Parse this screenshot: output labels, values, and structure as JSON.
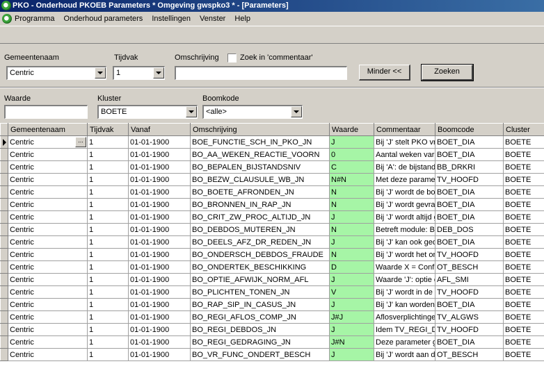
{
  "title": "PKO - Onderhoud PKOEB Parameters * Omgeving gwspko3 * - [Parameters]",
  "menu": [
    "Programma",
    "Onderhoud parameters",
    "Instellingen",
    "Venster",
    "Help"
  ],
  "filters": {
    "gemeentenaam_label": "Gemeentenaam",
    "gemeentenaam_value": "Centric",
    "tijdvak_label": "Tijdvak",
    "tijdvak_value": "1",
    "omschrijving_label": "Omschrijving",
    "omschrijving_value": "",
    "zoek_commentaar_label": "Zoek in 'commentaar'",
    "minder_label": "Minder <<",
    "zoeken_label": "Zoeken",
    "waarde_label": "Waarde",
    "waarde_value": "",
    "kluster_label": "Kluster",
    "kluster_value": "BOETE",
    "boomkode_label": "Boomkode",
    "boomkode_value": "<alle>"
  },
  "grid": {
    "columns": [
      "Gemeentenaam",
      "Tijdvak",
      "Vanaf",
      "Omschrijving",
      "Waarde",
      "Commentaar",
      "Boomcode",
      "Cluster"
    ],
    "rows": [
      [
        "Centric",
        "1",
        "01-01-1900",
        "BOE_FUNCTIE_SCH_IN_PKO_JN",
        "J",
        "Bij 'J' stelt PKO vra",
        "BOET_DIA",
        "BOETE"
      ],
      [
        "Centric",
        "1",
        "01-01-1900",
        "BO_AA_WEKEN_REACTIE_VOORN",
        "0",
        "Aantal weken var",
        "BOET_DIA",
        "BOETE"
      ],
      [
        "Centric",
        "1",
        "01-01-1900",
        "BO_BEPALEN_BIJSTANDSNIV",
        "C",
        "Bij 'A': de bijstands",
        "BB_DRKRI",
        "BOETE"
      ],
      [
        "Centric",
        "1",
        "01-01-1900",
        "BO_BEZW_CLAUSULE_WB_JN",
        "N#N",
        "Met deze paramet",
        "TV_HOOFD",
        "BOETE"
      ],
      [
        "Centric",
        "1",
        "01-01-1900",
        "BO_BOETE_AFRONDEN_JN",
        "N",
        "Bij 'J' wordt de boe",
        "BOET_DIA",
        "BOETE"
      ],
      [
        "Centric",
        "1",
        "01-01-1900",
        "BO_BRONNEN_IN_RAP_JN",
        "N",
        "Bij 'J' wordt gevra",
        "BOET_DIA",
        "BOETE"
      ],
      [
        "Centric",
        "1",
        "01-01-1900",
        "BO_CRIT_ZW_PROC_ALTIJD_JN",
        "J",
        "Bij 'J' wordt altijd g",
        "BOET_DIA",
        "BOETE"
      ],
      [
        "Centric",
        "1",
        "01-01-1900",
        "BO_DEBDOS_MUTEREN_JN",
        "N",
        "Betreft module: BO",
        "DEB_DOS",
        "BOETE"
      ],
      [
        "Centric",
        "1",
        "01-01-1900",
        "BO_DEELS_AFZ_DR_REDEN_JN",
        "J",
        "Bij 'J' kan ook ged",
        "BOET_DIA",
        "BOETE"
      ],
      [
        "Centric",
        "1",
        "01-01-1900",
        "BO_ONDERSCH_DEBDOS_FRAUDE",
        "N",
        "Bij 'J' wordt het on",
        "TV_HOOFD",
        "BOETE"
      ],
      [
        "Centric",
        "1",
        "01-01-1900",
        "BO_ONDERTEK_BESCHIKKING",
        "D",
        "Waarde X = Conf",
        "OT_BESCH",
        "BOETE"
      ],
      [
        "Centric",
        "1",
        "01-01-1900",
        "BO_OPTIE_AFWIJK_NORM_AFL",
        "J",
        "Waarde 'J': optie c",
        "AFL_SMI",
        "BOETE"
      ],
      [
        "Centric",
        "1",
        "01-01-1900",
        "BO_PLICHTEN_TONEN_JN",
        "V",
        "Bij 'J' wordt in de c",
        "TV_HOOFD",
        "BOETE"
      ],
      [
        "Centric",
        "1",
        "01-01-1900",
        "BO_RAP_SIP_IN_CASUS_JN",
        "J",
        "Bij 'J' kan worden",
        "BOET_DIA",
        "BOETE"
      ],
      [
        "Centric",
        "1",
        "01-01-1900",
        "BO_REGI_AFLOS_COMP_JN",
        "J#J",
        "Aflosverplichtinger",
        "TV_ALGWS",
        "BOETE"
      ],
      [
        "Centric",
        "1",
        "01-01-1900",
        "BO_REGI_DEBDOS_JN",
        "J",
        "Idem TV_REGI_D",
        "TV_HOOFD",
        "BOETE"
      ],
      [
        "Centric",
        "1",
        "01-01-1900",
        "BO_REGI_GEDRAGING_JN",
        "J#N",
        "Deze parameter g",
        "BOET_DIA",
        "BOETE"
      ],
      [
        "Centric",
        "1",
        "01-01-1900",
        "BO_VR_FUNC_ONDERT_BESCH",
        "J",
        "Bij 'J' wordt aan de",
        "OT_BESCH",
        "BOETE"
      ]
    ]
  },
  "colors": {
    "waarde_highlight": "#a6f5a6",
    "window_bg": "#d4d0c8"
  }
}
